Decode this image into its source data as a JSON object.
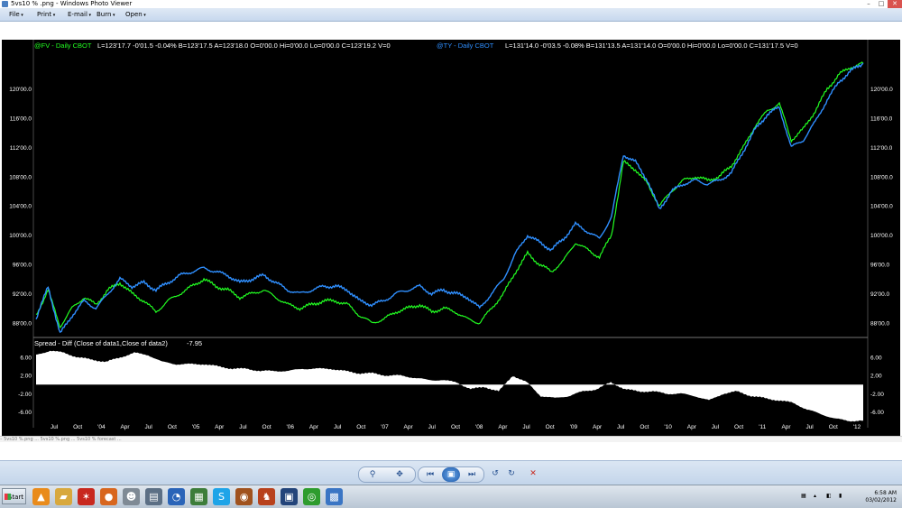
{
  "window": {
    "title": "5vs10 % .png - Windows Photo Viewer",
    "minimize": "–",
    "maximize": "□",
    "close": "✕"
  },
  "menu": {
    "items": [
      "File",
      "Print",
      "E-mail",
      "Burn",
      "Open"
    ]
  },
  "chart_data": [
    {
      "type": "line",
      "series": [
        {
          "name": "@FV - Daily  CBOT",
          "color": "#22ff22",
          "values": [
            89.0,
            92.5,
            87.5,
            90.0,
            91.5,
            90.5,
            92.5,
            93.5,
            92.0,
            91.0,
            89.5,
            91.0,
            92.0,
            93.0,
            94.0,
            93.0,
            92.5,
            91.5,
            92.0,
            92.5,
            91.5,
            90.5,
            90.0,
            90.5,
            91.0,
            91.0,
            90.5,
            89.0,
            88.0,
            88.5,
            89.5,
            90.0,
            90.5,
            89.5,
            90.0,
            89.5,
            88.5,
            88.0,
            90.0,
            92.0,
            95.0,
            97.5,
            96.0,
            95.0,
            96.5,
            99.0,
            98.0,
            97.0,
            100.0,
            110.0,
            109.0,
            107.0,
            104.0,
            106.0,
            107.5,
            108.0,
            107.5,
            108.0,
            109.5,
            112.0,
            115.0,
            117.0,
            118.0,
            113.0,
            114.5,
            117.0,
            120.0,
            122.0,
            123.0,
            123.5
          ]
        },
        {
          "name": "@TY - Daily  CBOT",
          "color": "#2f8fff",
          "values": [
            88.5,
            93.0,
            86.5,
            89.0,
            91.0,
            90.0,
            92.0,
            94.0,
            93.0,
            93.5,
            92.5,
            93.5,
            94.5,
            95.0,
            95.5,
            95.0,
            94.5,
            93.5,
            94.0,
            94.5,
            93.5,
            92.5,
            92.0,
            92.5,
            93.0,
            93.0,
            92.5,
            91.0,
            90.5,
            91.0,
            92.0,
            92.5,
            93.0,
            92.0,
            92.5,
            92.0,
            91.5,
            90.0,
            92.0,
            94.0,
            97.5,
            100.0,
            99.0,
            98.0,
            99.5,
            101.5,
            100.5,
            99.5,
            102.5,
            111.0,
            110.0,
            107.5,
            103.5,
            106.0,
            107.0,
            107.5,
            107.0,
            107.5,
            108.5,
            111.5,
            114.5,
            116.5,
            117.5,
            112.0,
            113.0,
            115.5,
            118.5,
            121.0,
            122.5,
            123.5
          ]
        }
      ],
      "status_texts": [
        {
          "text": "@FV - Daily  CBOT",
          "color": "#22ff22"
        },
        {
          "text": "L=123'17.7  -0'01.5  -0.04%  B=123'17.5  A=123'18.0  O=0'00.0  Hi=0'00.0  Lo=0'00.0  C=123'19.2  V=0",
          "color": "#ffffff"
        },
        {
          "text": "@TY - Daily  CBOT",
          "color": "#2f8fff"
        },
        {
          "text": "L=131'14.0  -0'03.5  -0.08%  B=131'13.5  A=131'14.0  O=0'00.0  Hi=0'00.0  Lo=0'00.0  C=131'17.5  V=0",
          "color": "#ffffff"
        }
      ],
      "ylim": [
        86.5,
        125.0
      ],
      "y_ticks": [
        "120'00.0",
        "116'00.0",
        "112'00.0",
        "108'00.0",
        "104'00.0",
        "100'00.0",
        "96'00.0",
        "92'00.0",
        "88'00.0"
      ],
      "y_tick_values": [
        120,
        116,
        112,
        108,
        104,
        100,
        96,
        92,
        88
      ]
    },
    {
      "type": "area",
      "title": "Spread - Diff (Close of data1,Close of data2)",
      "last_value": "-7.95",
      "series": [
        {
          "name": "Spread",
          "color": "#ffffff",
          "values": [
            6.5,
            7.5,
            7.0,
            6.0,
            5.5,
            5.0,
            6.0,
            7.0,
            6.5,
            5.0,
            4.5,
            4.5,
            4.5,
            4.0,
            3.5,
            3.5,
            3.0,
            3.0,
            3.0,
            3.5,
            3.5,
            3.5,
            3.0,
            2.5,
            2.5,
            2.0,
            2.0,
            1.5,
            1.0,
            1.0,
            0.5,
            -1.0,
            -0.5,
            -1.5,
            2.0,
            0.5,
            -2.5,
            -3.0,
            -2.5,
            -1.5,
            -1.0,
            0.5,
            -1.0,
            -1.5,
            -1.5,
            -2.0,
            -2.0,
            -2.5,
            -3.5,
            -2.0,
            -1.5,
            -2.5,
            -3.0,
            -3.5,
            -4.0,
            -5.5,
            -6.5,
            -7.5,
            -8.0,
            -7.95
          ]
        }
      ],
      "ylim": [
        -7.5,
        8.0
      ],
      "y_ticks": [
        "6.00",
        "2.00",
        "-2.00",
        "-6.00"
      ],
      "y_tick_values": [
        6,
        2,
        -2,
        -6
      ],
      "x_ticks": [
        "Jul",
        "Oct",
        "'04",
        "Apr",
        "Jul",
        "Oct",
        "'05",
        "Apr",
        "Jul",
        "Oct",
        "'06",
        "Apr",
        "Jul",
        "Oct",
        "'07",
        "Apr",
        "Jul",
        "Oct",
        "'08",
        "Apr",
        "Jul",
        "Oct",
        "'09",
        "Apr",
        "Jul",
        "Oct",
        "'10",
        "Apr",
        "Jul",
        "Oct",
        "'11",
        "Apr",
        "Jul",
        "Oct",
        "'12"
      ]
    }
  ],
  "statusbar": {
    "text": "– 5vs10 %.png  ...  5vs10 %.png  ...  5vs10 % forecast ..."
  },
  "toolbar": {
    "zoom": "⚲",
    "fit": "✥",
    "prev": "⏮",
    "slideshow": "▣",
    "next": "⏭",
    "rotate_ccw": "↺",
    "rotate_cw": "↻",
    "delete": "✕"
  },
  "taskbar": {
    "start_label": "Start",
    "icons": [
      {
        "name": "vlc-icon",
        "glyph": "▲",
        "color": "#e98b1b"
      },
      {
        "name": "folder-icon",
        "glyph": "▰",
        "color": "#d8a83d"
      },
      {
        "name": "star-app-icon",
        "glyph": "✶",
        "color": "#c8281e"
      },
      {
        "name": "firefox-icon",
        "glyph": "●",
        "color": "#d8661e"
      },
      {
        "name": "alien-icon",
        "glyph": "☻",
        "color": "#7f8a95"
      },
      {
        "name": "monitor-icon",
        "glyph": "▤",
        "color": "#5c6f85"
      },
      {
        "name": "network-icon",
        "glyph": "◔",
        "color": "#2a64b8"
      },
      {
        "name": "calculator-icon",
        "glyph": "▦",
        "color": "#3d7d3a"
      },
      {
        "name": "skype-icon",
        "glyph": "S",
        "color": "#1ea4e8"
      },
      {
        "name": "media-icon",
        "glyph": "◉",
        "color": "#a0521e"
      },
      {
        "name": "fox-icon",
        "glyph": "♞",
        "color": "#b8411c"
      },
      {
        "name": "photo-app-icon",
        "glyph": "▣",
        "color": "#23447a"
      },
      {
        "name": "green-app-icon",
        "glyph": "◎",
        "color": "#2e9c2e"
      },
      {
        "name": "photo-viewer-icon",
        "glyph": "▩",
        "color": "#3a75c4"
      }
    ],
    "time": "6:58 AM",
    "date": "03/02/2012"
  }
}
